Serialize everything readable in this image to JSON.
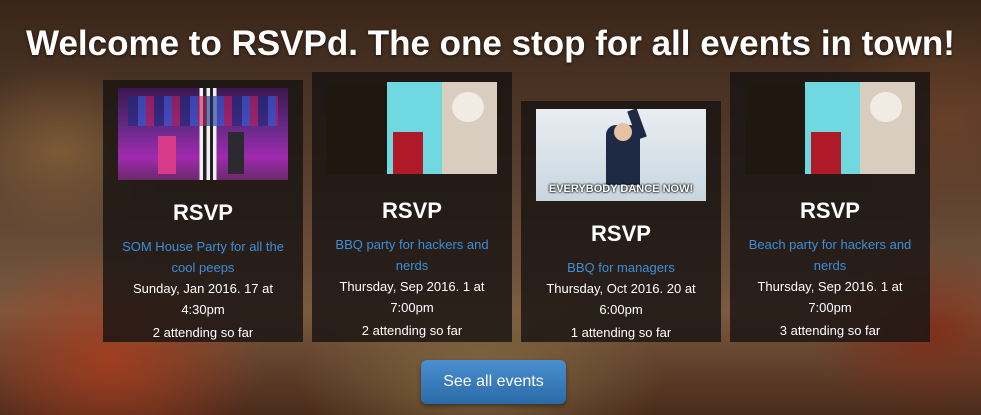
{
  "header": {
    "title": "Welcome to RSVPd. The one stop for all events in town!"
  },
  "events": [
    {
      "heading": "RSVP",
      "name": "SOM House Party for all the cool peeps",
      "when": "Sunday, Jan 2016. 17 at 4:30pm",
      "attending": "2 attending so far"
    },
    {
      "heading": "RSVP",
      "name": "BBQ party for hackers and nerds",
      "when": "Thursday, Sep 2016. 1 at 7:00pm",
      "attending": "2 attending so far"
    },
    {
      "heading": "RSVP",
      "name": "BBQ for managers",
      "when": "Thursday, Oct 2016. 20 at 6:00pm",
      "attending": "1 attending so far",
      "image_caption": "EVERYBODY DANCE NOW!"
    },
    {
      "heading": "RSVP",
      "name": "Beach party for hackers and nerds",
      "when": "Thursday, Sep 2016. 1 at 7:00pm",
      "attending": "3 attending so far"
    }
  ],
  "actions": {
    "see_all_label": "See all events"
  },
  "colors": {
    "link": "#3d8fd6",
    "button": "#337ab7",
    "card_background": "rgba(25,20,18,0.82)"
  }
}
